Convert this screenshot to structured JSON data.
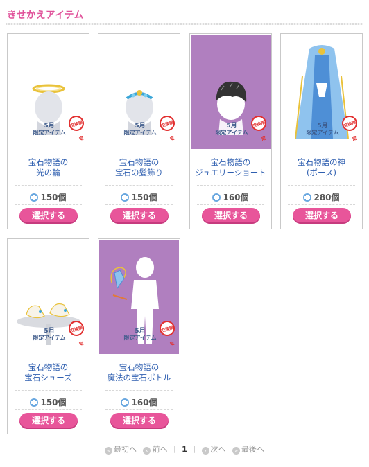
{
  "header": {
    "title": "きせかえアイテム"
  },
  "badge": {
    "month": "5月",
    "label": "限定アイテム",
    "limited": "交換限定"
  },
  "items": [
    {
      "name1": "宝石物語の",
      "name2": "光の輪",
      "price": "150個",
      "button": "選択する",
      "purple": false
    },
    {
      "name1": "宝石物語の",
      "name2": "宝石の髪飾り",
      "price": "150個",
      "button": "選択する",
      "purple": false
    },
    {
      "name1": "宝石物語の",
      "name2": "ジュエリーショート",
      "price": "160個",
      "button": "選択する",
      "purple": true
    },
    {
      "name1": "宝石物語の神",
      "name2": "(ポース)",
      "price": "280個",
      "button": "選択する",
      "purple": false
    },
    {
      "name1": "宝石物語の",
      "name2": "宝石シューズ",
      "price": "150個",
      "button": "選択する",
      "purple": false
    },
    {
      "name1": "宝石物語の",
      "name2": "魔法の宝石ボトル",
      "price": "160個",
      "button": "選択する",
      "purple": true
    }
  ],
  "pager": {
    "first": "最初へ",
    "prev": "前へ",
    "current": "1",
    "next": "次へ",
    "last": "最後へ"
  },
  "colors": {
    "accent": "#e0529a",
    "button": "#e8559a",
    "link": "#2f5fb0",
    "purple_bg": "#b07fbf"
  }
}
